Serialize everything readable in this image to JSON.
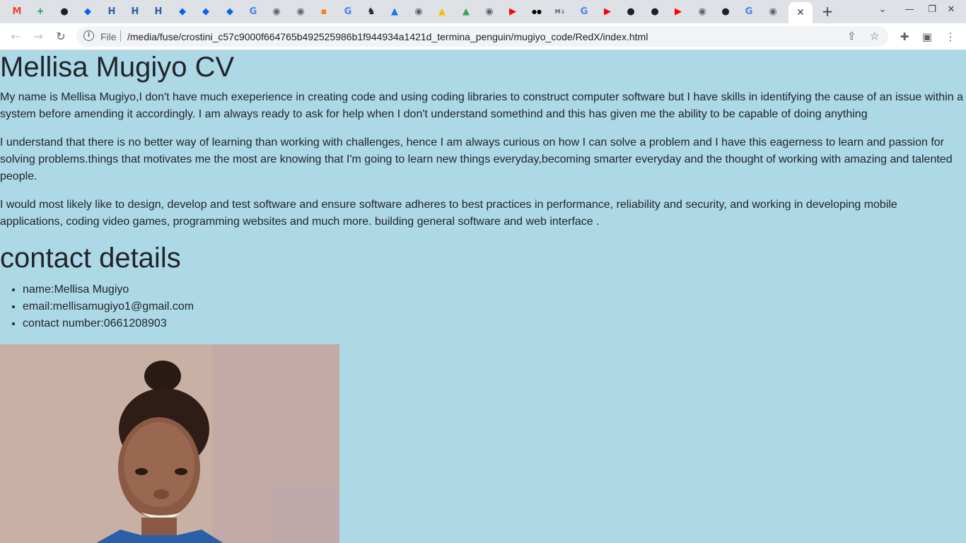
{
  "browser": {
    "tabs": [
      {
        "icon": "gmail-icon",
        "color": "#ea4335",
        "glyph": "M"
      },
      {
        "icon": "sheets-icon",
        "color": "#0f9d58",
        "glyph": "+"
      },
      {
        "icon": "app-icon",
        "color": "#202124",
        "glyph": "●"
      },
      {
        "icon": "dropbox-icon",
        "color": "#0061fe",
        "glyph": "◆"
      },
      {
        "icon": "hyperskill-icon",
        "color": "#2f5fa6",
        "glyph": "H"
      },
      {
        "icon": "hyperskill-icon",
        "color": "#2f5fa6",
        "glyph": "H"
      },
      {
        "icon": "hyperskill-icon",
        "color": "#2f5fa6",
        "glyph": "H"
      },
      {
        "icon": "dropbox-icon",
        "color": "#0061fe",
        "glyph": "◆"
      },
      {
        "icon": "dropbox-icon",
        "color": "#0061fe",
        "glyph": "◆"
      },
      {
        "icon": "dropbox-icon",
        "color": "#0061fe",
        "glyph": "◆"
      },
      {
        "icon": "google-icon",
        "color": "#4285f4",
        "glyph": "G"
      },
      {
        "icon": "globe-icon",
        "color": "#5f6368",
        "glyph": "◉"
      },
      {
        "icon": "globe-icon",
        "color": "#5f6368",
        "glyph": "◉"
      },
      {
        "icon": "app-icon",
        "color": "#f4811f",
        "glyph": "▪"
      },
      {
        "icon": "google-icon",
        "color": "#4285f4",
        "glyph": "G"
      },
      {
        "icon": "cat-icon",
        "color": "#202124",
        "glyph": "♞"
      },
      {
        "icon": "app-icon",
        "color": "#1a73e8",
        "glyph": "▲"
      },
      {
        "icon": "globe-icon",
        "color": "#5f6368",
        "glyph": "◉"
      },
      {
        "icon": "drive-icon",
        "color": "#fbbc04",
        "glyph": "▲"
      },
      {
        "icon": "drive-icon",
        "color": "#34a853",
        "glyph": "▲"
      },
      {
        "icon": "globe-icon",
        "color": "#5f6368",
        "glyph": "◉"
      },
      {
        "icon": "youtube-icon",
        "color": "#ff0000",
        "glyph": "▶"
      },
      {
        "icon": "medium-icon",
        "color": "#000000",
        "glyph": "●●"
      },
      {
        "icon": "markdown-icon",
        "color": "#5f6368",
        "glyph": "M↓"
      },
      {
        "icon": "google-icon",
        "color": "#4285f4",
        "glyph": "G"
      },
      {
        "icon": "youtube-icon",
        "color": "#ff0000",
        "glyph": "▶"
      },
      {
        "icon": "github-icon",
        "color": "#202124",
        "glyph": "●"
      },
      {
        "icon": "github-icon",
        "color": "#202124",
        "glyph": "●"
      },
      {
        "icon": "youtube-icon",
        "color": "#ff0000",
        "glyph": "▶"
      },
      {
        "icon": "globe-icon",
        "color": "#5f6368",
        "glyph": "◉"
      },
      {
        "icon": "github-icon",
        "color": "#202124",
        "glyph": "●"
      },
      {
        "icon": "google-icon",
        "color": "#4285f4",
        "glyph": "G"
      },
      {
        "icon": "globe-icon",
        "color": "#5f6368",
        "glyph": "◉"
      }
    ],
    "active_tab_close": "✕",
    "new_tab": "+",
    "omnibox": {
      "scheme_label": "File",
      "url": "/media/fuse/crostini_c57c9000f664765b492525986b1f944934a1421d_termina_penguin/mugiyo_code/RedX/index.html"
    }
  },
  "page": {
    "title": "Mellisa Mugiyo CV",
    "paragraphs": [
      "My name is Mellisa Mugiyo,I don't have much exeperience in creating code and using coding libraries to construct computer software but I have skills in identifying the cause of an issue within a system before amending it accordingly. I am always ready to ask for help when I don't understand somethind and this has given me the ability to be capable of doing anything",
      "I understand that there is no better way of learning than working with challenges, hence I am always curious on how I can solve a problem and I have this eagerness to learn and passion for solving problems.things that motivates me the most are knowing that I'm going to learn new things everyday,becoming smarter everyday and the thought of working with amazing and talented people.",
      "I would most likely like to design, develop and test software and ensure software adheres to best practices in performance, reliability and security, and working in developing mobile applications, coding video games, programming websites and much more. building general software and web interface ."
    ],
    "contact_heading": "contact details",
    "contacts": [
      "name:Mellisa Mugiyo",
      "email:mellisamugiyo1@gmail.com",
      "contact number:0661208903"
    ],
    "background_color": "#add8e6"
  }
}
